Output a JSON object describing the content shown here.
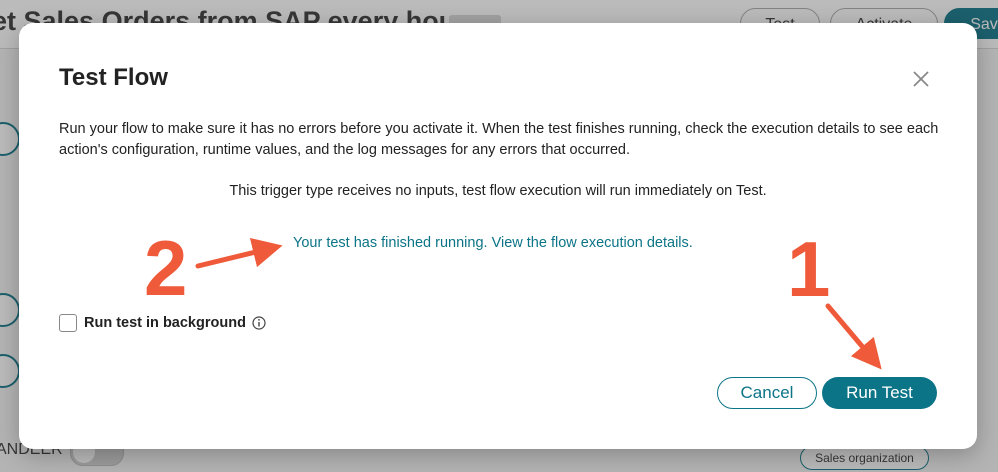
{
  "background": {
    "page_title": "et Sales Orders from SAP every hour",
    "buttons": {
      "test": "Test",
      "activate": "Activate",
      "save": "Sav"
    },
    "bottom_label": "ANDEER",
    "pill": "Sales organization"
  },
  "dialog": {
    "title": "Test Flow",
    "close_icon": "close-icon",
    "description": "Run your flow to make sure it has no errors before you activate it. When the test finishes running, check the execution details to see each action's configuration, runtime values, and the log messages for any errors that occurred.",
    "trigger_note": "This trigger type receives no inputs, test flow execution will run immediately on Test.",
    "result_link": "Your test has finished running. View the flow execution details.",
    "checkbox_label": "Run test in background",
    "checkbox_checked": false,
    "info_icon": "info-icon",
    "cancel_label": "Cancel",
    "run_label": "Run Test",
    "accent_color": "#0c7487"
  },
  "annotations": {
    "step1": "1",
    "step2": "2",
    "color": "#ef5a3a"
  }
}
